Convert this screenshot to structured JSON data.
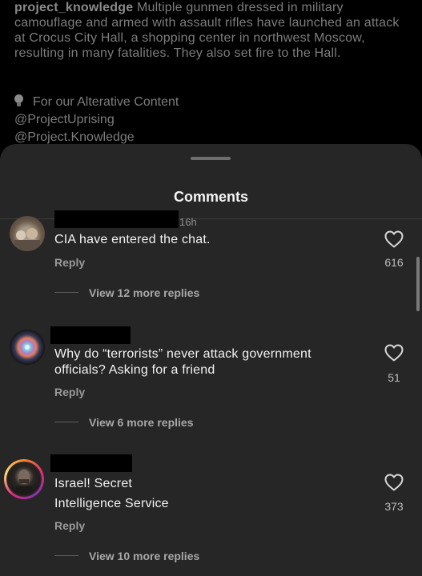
{
  "caption": {
    "username": "project_knowledge",
    "text": " Multiple gunmen dressed in military camouflage and armed with assault rifles have launched an attack at Crocus City Hall, a shopping center in northwest Moscow, resulting in many fatalities. They also set fire to the Hall.",
    "promo": "For our Alterative Content",
    "handle1": "@ProjectUprising",
    "handle2": "@Project.Knowledge"
  },
  "sheet": {
    "title": "Comments"
  },
  "comments": [
    {
      "time": "16h",
      "text": "CIA have entered the chat.",
      "reply_label": "Reply",
      "likes": "616",
      "view_replies": "View 12 more replies"
    },
    {
      "text_line1": "Why do “terrorists” never attack government",
      "text_line2": "officials? Asking for a friend",
      "reply_label": "Reply",
      "likes": "51",
      "view_replies": "View 6 more replies"
    },
    {
      "text_line1": "Israel! Secret",
      "text_line2": "Intelligence Service",
      "reply_label": "Reply",
      "likes": "373",
      "view_replies": "View 10 more replies"
    }
  ],
  "icons": {
    "like": "heart-outline-icon",
    "promo": "lightbulb-icon"
  },
  "colors": {
    "sheet_bg": "#262626",
    "page_bg": "#000000",
    "story_ring": "#d62976"
  }
}
